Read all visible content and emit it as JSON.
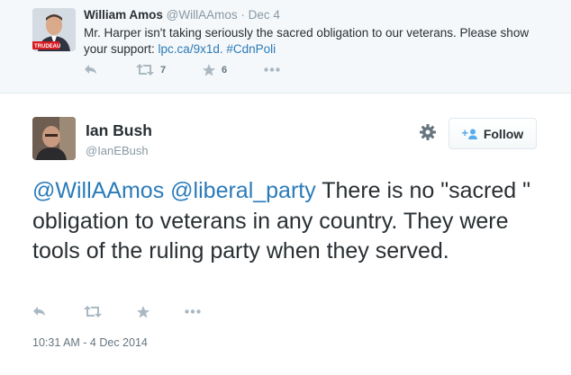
{
  "parent_tweet": {
    "name": "William Amos",
    "handle": "@WillAAmos",
    "separator": "·",
    "date": "Dec 4",
    "text_prefix": "Mr. Harper isn't taking seriously the sacred obligation to our veterans. Please show your support: ",
    "link_url": "lpc.ca/9x1d.",
    "hashtag": "#CdnPoli",
    "avatar_badge": "TRUDEAU",
    "avatar_badge_color": "#d71920",
    "retweet_count": "7",
    "favorite_count": "6",
    "actions": [
      "reply-icon",
      "retweet-icon",
      "favorite-icon",
      "more-icon"
    ]
  },
  "main_tweet": {
    "name": "Ian Bush",
    "handle": "@IanEBush",
    "follow_label": "Follow",
    "mention_1": "@WillAAmos",
    "mention_2": "@liberal_party",
    "text": "There is no \"sacred \" obligation to veterans in any country. They were tools of the ruling party when they served.",
    "timestamp": "10:31 AM - 4 Dec 2014",
    "actions": [
      "reply-icon",
      "retweet-icon",
      "favorite-icon",
      "more-icon"
    ]
  },
  "colors": {
    "link": "#2b7bb9",
    "icon": "#aab8c2",
    "muted": "#8899a6",
    "parent_bg": "#f5f8fa"
  }
}
